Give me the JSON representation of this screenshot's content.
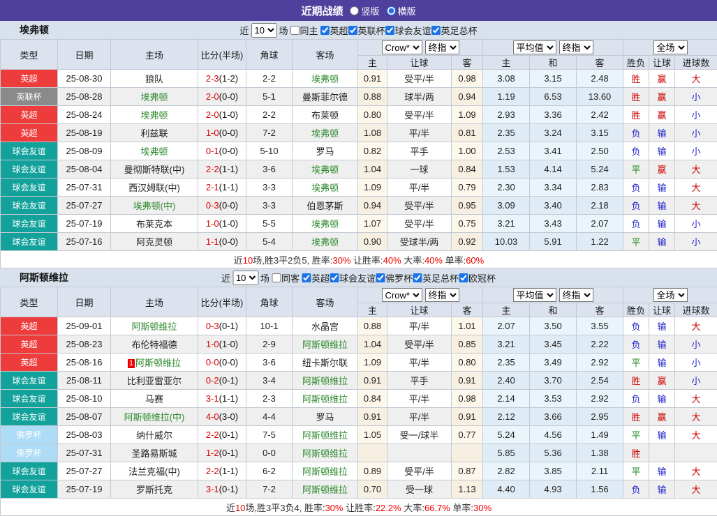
{
  "topbar": {
    "title": "近期战绩",
    "radios": [
      {
        "label": "竖版",
        "checked": false
      },
      {
        "label": "横版",
        "checked": true
      }
    ]
  },
  "table_header": {
    "cols": [
      "类型",
      "日期",
      "主场",
      "比分(半场)",
      "角球",
      "客场"
    ],
    "selects": [
      "Crow*",
      "终指",
      "平均值",
      "终指",
      "全场"
    ],
    "sub_cols": [
      "主",
      "让球",
      "客",
      "主",
      "和",
      "客",
      "胜负",
      "让球",
      "进球数"
    ]
  },
  "colors": {
    "purple": "#4e409c",
    "page_bg": "#d9e2ec",
    "team_green": "#2f8a2f",
    "score_red": "#dd0000",
    "badge": {
      "英超": "#ee3b3b",
      "英联杯": "#8a8a8a",
      "球会友谊": "#12a19b",
      "佛罗杯": "#aedcf6"
    },
    "result": {
      "胜": "#cc0000",
      "平": "#1f8a1f",
      "负": "#2222cc",
      "赢": "#cc0000",
      "输": "#2222cc",
      "大": "#cc0000",
      "小": "#2222cc"
    }
  },
  "sections": [
    {
      "team": "埃弗顿",
      "filter": {
        "near": "近",
        "count": "10",
        "games": "场",
        "same": {
          "label": "同主",
          "checked": false
        },
        "comps": [
          {
            "label": "英超",
            "checked": true
          },
          {
            "label": "英联杯",
            "checked": true
          },
          {
            "label": "球会友谊",
            "checked": true
          },
          {
            "label": "英足总杯",
            "checked": true
          }
        ]
      },
      "rows": [
        {
          "type": "英超",
          "date": "25-08-30",
          "home": "狼队",
          "home_green": false,
          "home_card": "",
          "score": "2-3",
          "half": "(1-2)",
          "corner": "2-2",
          "away": "埃弗顿",
          "away_green": true,
          "o1": "0.91",
          "handicap": "受平/半",
          "o2": "0.98",
          "a1": "3.08",
          "a2": "3.15",
          "a3": "2.48",
          "r1": "胜",
          "r2": "赢",
          "r3": "大"
        },
        {
          "type": "英联杯",
          "date": "25-08-28",
          "home": "埃弗顿",
          "home_green": true,
          "home_card": "",
          "score": "2-0",
          "half": "(0-0)",
          "corner": "5-1",
          "away": "曼斯菲尔德",
          "away_green": false,
          "o1": "0.88",
          "handicap": "球半/两",
          "o2": "0.94",
          "a1": "1.19",
          "a2": "6.53",
          "a3": "13.60",
          "r1": "胜",
          "r2": "赢",
          "r3": "小"
        },
        {
          "type": "英超",
          "date": "25-08-24",
          "home": "埃弗顿",
          "home_green": true,
          "home_card": "",
          "score": "2-0",
          "half": "(1-0)",
          "corner": "2-2",
          "away": "布莱顿",
          "away_green": false,
          "o1": "0.80",
          "handicap": "受平/半",
          "o2": "1.09",
          "a1": "2.93",
          "a2": "3.36",
          "a3": "2.42",
          "r1": "胜",
          "r2": "赢",
          "r3": "小"
        },
        {
          "type": "英超",
          "date": "25-08-19",
          "home": "利兹联",
          "home_green": false,
          "home_card": "",
          "score": "1-0",
          "half": "(0-0)",
          "corner": "7-2",
          "away": "埃弗顿",
          "away_green": true,
          "o1": "1.08",
          "handicap": "平/半",
          "o2": "0.81",
          "a1": "2.35",
          "a2": "3.24",
          "a3": "3.15",
          "r1": "负",
          "r2": "输",
          "r3": "小"
        },
        {
          "type": "球会友谊",
          "date": "25-08-09",
          "home": "埃弗顿",
          "home_green": true,
          "home_card": "",
          "score": "0-1",
          "half": "(0-0)",
          "corner": "5-10",
          "away": "罗马",
          "away_green": false,
          "o1": "0.82",
          "handicap": "平手",
          "o2": "1.00",
          "a1": "2.53",
          "a2": "3.41",
          "a3": "2.50",
          "r1": "负",
          "r2": "输",
          "r3": "小"
        },
        {
          "type": "球会友谊",
          "date": "25-08-04",
          "home": "曼彻斯特联(中)",
          "home_green": false,
          "home_card": "",
          "score": "2-2",
          "half": "(1-1)",
          "corner": "3-6",
          "away": "埃弗顿",
          "away_green": true,
          "o1": "1.04",
          "handicap": "一球",
          "o2": "0.84",
          "a1": "1.53",
          "a2": "4.14",
          "a3": "5.24",
          "r1": "平",
          "r2": "赢",
          "r3": "大"
        },
        {
          "type": "球会友谊",
          "date": "25-07-31",
          "home": "西汉姆联(中)",
          "home_green": false,
          "home_card": "",
          "score": "2-1",
          "half": "(1-1)",
          "corner": "3-3",
          "away": "埃弗顿",
          "away_green": true,
          "o1": "1.09",
          "handicap": "平/半",
          "o2": "0.79",
          "a1": "2.30",
          "a2": "3.34",
          "a3": "2.83",
          "r1": "负",
          "r2": "输",
          "r3": "大"
        },
        {
          "type": "球会友谊",
          "date": "25-07-27",
          "home": "埃弗顿(中)",
          "home_green": true,
          "home_card": "",
          "score": "0-3",
          "half": "(0-0)",
          "corner": "3-3",
          "away": "伯恩茅斯",
          "away_green": false,
          "o1": "0.94",
          "handicap": "受平/半",
          "o2": "0.95",
          "a1": "3.09",
          "a2": "3.40",
          "a3": "2.18",
          "r1": "负",
          "r2": "输",
          "r3": "大"
        },
        {
          "type": "球会友谊",
          "date": "25-07-19",
          "home": "布莱克本",
          "home_green": false,
          "home_card": "",
          "score": "1-0",
          "half": "(1-0)",
          "corner": "5-5",
          "away": "埃弗顿",
          "away_green": true,
          "o1": "1.07",
          "handicap": "受平/半",
          "o2": "0.75",
          "a1": "3.21",
          "a2": "3.43",
          "a3": "2.07",
          "r1": "负",
          "r2": "输",
          "r3": "小"
        },
        {
          "type": "球会友谊",
          "date": "25-07-16",
          "home": "阿克灵顿",
          "home_green": false,
          "home_card": "",
          "score": "1-1",
          "half": "(0-0)",
          "corner": "5-4",
          "away": "埃弗顿",
          "away_green": true,
          "o1": "0.90",
          "handicap": "受球半/两",
          "o2": "0.92",
          "a1": "10.03",
          "a2": "5.91",
          "a3": "1.22",
          "r1": "平",
          "r2": "输",
          "r3": "小"
        }
      ],
      "summary": [
        {
          "t": "近"
        },
        {
          "t": "10",
          "red": true
        },
        {
          "t": "场,胜3平2负5, 胜率:"
        },
        {
          "t": "30%",
          "red": true
        },
        {
          "t": " 让胜率:"
        },
        {
          "t": "40%",
          "red": true
        },
        {
          "t": " 大率:"
        },
        {
          "t": "40%",
          "red": true
        },
        {
          "t": " 单率:"
        },
        {
          "t": "60%",
          "red": true
        }
      ]
    },
    {
      "team": "阿斯顿维拉",
      "filter": {
        "near": "近",
        "count": "10",
        "games": "场",
        "same": {
          "label": "同客",
          "checked": false
        },
        "comps": [
          {
            "label": "英超",
            "checked": true
          },
          {
            "label": "球会友谊",
            "checked": true
          },
          {
            "label": "佛罗杯",
            "checked": true
          },
          {
            "label": "英足总杯",
            "checked": true
          },
          {
            "label": "欧冠杯",
            "checked": true
          }
        ]
      },
      "rows": [
        {
          "type": "英超",
          "date": "25-09-01",
          "home": "阿斯顿维拉",
          "home_green": true,
          "home_card": "",
          "score": "0-3",
          "half": "(0-1)",
          "corner": "10-1",
          "away": "水晶宫",
          "away_green": false,
          "o1": "0.88",
          "handicap": "平/半",
          "o2": "1.01",
          "a1": "2.07",
          "a2": "3.50",
          "a3": "3.55",
          "r1": "负",
          "r2": "输",
          "r3": "大"
        },
        {
          "type": "英超",
          "date": "25-08-23",
          "home": "布伦特福德",
          "home_green": false,
          "home_card": "",
          "score": "1-0",
          "half": "(1-0)",
          "corner": "2-9",
          "away": "阿斯顿维拉",
          "away_green": true,
          "o1": "1.04",
          "handicap": "受平/半",
          "o2": "0.85",
          "a1": "3.21",
          "a2": "3.45",
          "a3": "2.22",
          "r1": "负",
          "r2": "输",
          "r3": "小"
        },
        {
          "type": "英超",
          "date": "25-08-16",
          "home": "阿斯顿维拉",
          "home_green": true,
          "home_card": "1",
          "score": "0-0",
          "half": "(0-0)",
          "corner": "3-6",
          "away": "纽卡斯尔联",
          "away_green": false,
          "o1": "1.09",
          "handicap": "平/半",
          "o2": "0.80",
          "a1": "2.35",
          "a2": "3.49",
          "a3": "2.92",
          "r1": "平",
          "r2": "输",
          "r3": "小"
        },
        {
          "type": "球会友谊",
          "date": "25-08-11",
          "home": "比利亚雷亚尔",
          "home_green": false,
          "home_card": "",
          "score": "0-2",
          "half": "(0-1)",
          "corner": "3-4",
          "away": "阿斯顿维拉",
          "away_green": true,
          "o1": "0.91",
          "handicap": "平手",
          "o2": "0.91",
          "a1": "2.40",
          "a2": "3.70",
          "a3": "2.54",
          "r1": "胜",
          "r2": "赢",
          "r3": "小"
        },
        {
          "type": "球会友谊",
          "date": "25-08-10",
          "home": "马赛",
          "home_green": false,
          "home_card": "",
          "score": "3-1",
          "half": "(1-1)",
          "corner": "2-3",
          "away": "阿斯顿维拉",
          "away_green": true,
          "o1": "0.84",
          "handicap": "平/半",
          "o2": "0.98",
          "a1": "2.14",
          "a2": "3.53",
          "a3": "2.92",
          "r1": "负",
          "r2": "输",
          "r3": "大"
        },
        {
          "type": "球会友谊",
          "date": "25-08-07",
          "home": "阿斯顿维拉(中)",
          "home_green": true,
          "home_card": "",
          "score": "4-0",
          "half": "(3-0)",
          "corner": "4-4",
          "away": "罗马",
          "away_green": false,
          "o1": "0.91",
          "handicap": "平/半",
          "o2": "0.91",
          "a1": "2.12",
          "a2": "3.66",
          "a3": "2.95",
          "r1": "胜",
          "r2": "赢",
          "r3": "大"
        },
        {
          "type": "佛罗杯",
          "date": "25-08-03",
          "home": "纳什威尔",
          "home_green": false,
          "home_card": "",
          "score": "2-2",
          "half": "(0-1)",
          "corner": "7-5",
          "away": "阿斯顿维拉",
          "away_green": true,
          "o1": "1.05",
          "handicap": "受一/球半",
          "o2": "0.77",
          "a1": "5.24",
          "a2": "4.56",
          "a3": "1.49",
          "r1": "平",
          "r2": "输",
          "r3": "大"
        },
        {
          "type": "佛罗杯",
          "date": "25-07-31",
          "home": "圣路易斯城",
          "home_green": false,
          "home_card": "",
          "score": "1-2",
          "half": "(0-1)",
          "corner": "0-0",
          "away": "阿斯顿维拉",
          "away_green": true,
          "o1": "",
          "handicap": "",
          "o2": "",
          "a1": "5.85",
          "a2": "5.36",
          "a3": "1.38",
          "r1": "胜",
          "r2": "",
          "r3": ""
        },
        {
          "type": "球会友谊",
          "date": "25-07-27",
          "home": "法兰克福(中)",
          "home_green": false,
          "home_card": "",
          "score": "2-2",
          "half": "(1-1)",
          "corner": "6-2",
          "away": "阿斯顿维拉",
          "away_green": true,
          "o1": "0.89",
          "handicap": "受平/半",
          "o2": "0.87",
          "a1": "2.82",
          "a2": "3.85",
          "a3": "2.11",
          "r1": "平",
          "r2": "输",
          "r3": "大"
        },
        {
          "type": "球会友谊",
          "date": "25-07-19",
          "home": "罗斯托克",
          "home_green": false,
          "home_card": "",
          "score": "3-1",
          "half": "(0-1)",
          "corner": "7-2",
          "away": "阿斯顿维拉",
          "away_green": true,
          "o1": "0.70",
          "handicap": "受一球",
          "o2": "1.13",
          "a1": "4.40",
          "a2": "4.93",
          "a3": "1.56",
          "r1": "负",
          "r2": "输",
          "r3": "大"
        }
      ],
      "summary": [
        {
          "t": "近"
        },
        {
          "t": "10",
          "red": true
        },
        {
          "t": "场,胜3平3负4, 胜率:"
        },
        {
          "t": "30%",
          "red": true
        },
        {
          "t": " 让胜率:"
        },
        {
          "t": "22.2%",
          "red": true
        },
        {
          "t": " 大率:"
        },
        {
          "t": "66.7%",
          "red": true
        },
        {
          "t": " 单率:"
        },
        {
          "t": "30%",
          "red": true
        }
      ]
    }
  ]
}
